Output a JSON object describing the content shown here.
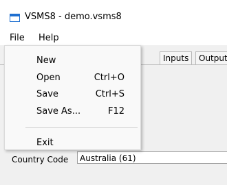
{
  "window": {
    "title": "VSMS8 - demo.vsms8"
  },
  "menubar": {
    "file": "File",
    "help": "Help"
  },
  "file_menu": {
    "new": "New",
    "open": "Open",
    "open_shortcut": "Ctrl+O",
    "save": "Save",
    "save_shortcut": "Ctrl+S",
    "save_as": "Save As...",
    "save_as_shortcut": "F12",
    "exit": "Exit"
  },
  "tabs": {
    "inputs": "Inputs",
    "output": "Output"
  },
  "form": {
    "country_code_label": "Country Code",
    "country_code_value": "Australia (61)"
  },
  "colors": {
    "accent": "#1f6fd0"
  }
}
